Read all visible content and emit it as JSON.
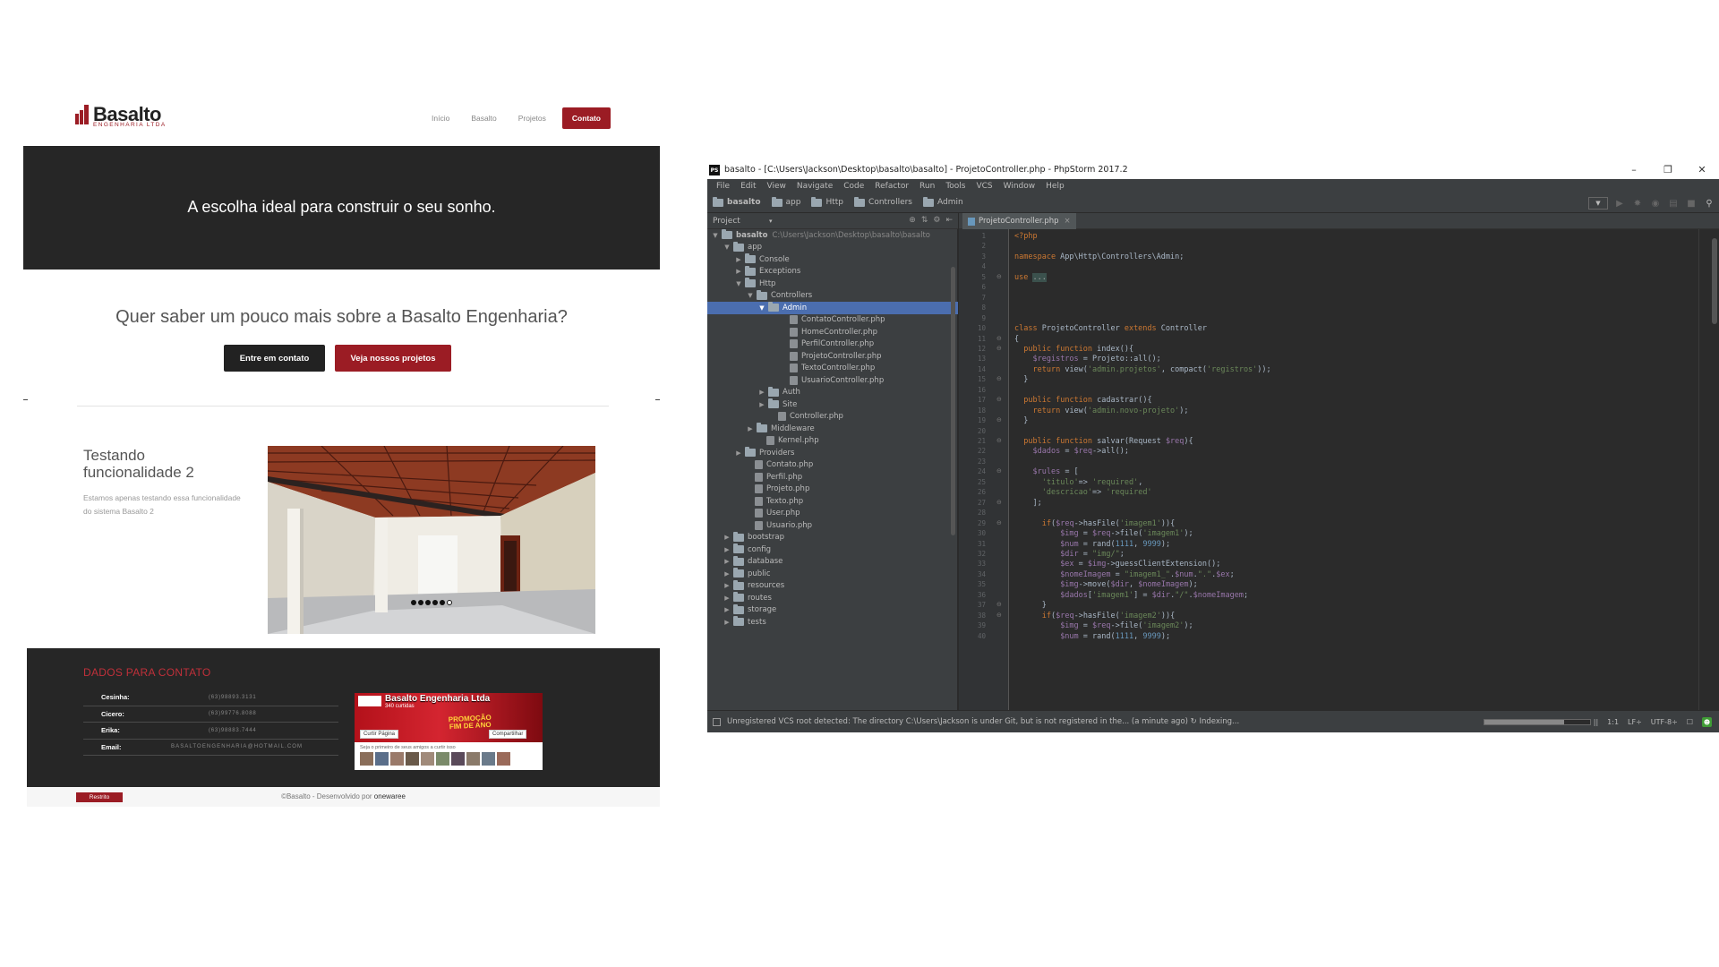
{
  "website": {
    "logo": {
      "name": "Basalto",
      "subtitle": "ENGENHARIA LTDA"
    },
    "nav": [
      "Início",
      "Basalto",
      "Projetos"
    ],
    "nav_cta": "Contato",
    "hero_title": "A escolha ideal para construir o seu sonho.",
    "about_title": "Quer saber um pouco mais sobre a Basalto Engenharia?",
    "btn_contact": "Entre em contato",
    "btn_projects": "Veja nossos projetos",
    "project": {
      "title": "Testando funcionalidade 2",
      "description": "Estamos apenas testando essa funcionalidade do sistema Basalto 2",
      "slide_count": 6,
      "active_slide": 6
    },
    "contact": {
      "heading": "DADOS PARA CONTATO",
      "rows": [
        {
          "name": "Cesinha:",
          "value": "(63)98893.3131"
        },
        {
          "name": "Cicero:",
          "value": "(63)99776.8088"
        },
        {
          "name": "Erika:",
          "value": "(63)98883.7444"
        }
      ],
      "email_label": "Email:",
      "email_value": "BASALTOENGENHARIA@HOTMAIL.COM"
    },
    "facebook": {
      "page_name": "Basalto Engenharia Ltda",
      "likes": "340 curtidas",
      "promo": "PROMOÇÃO\nFIM DE ANO",
      "like_btn": "Curtir Página",
      "share_btn": "Compartilhar",
      "friends_text": "Seja o primeiro de seus amigos a curtir isso"
    },
    "footer": {
      "restrito": "Restrito",
      "copyright": "©Basalto - Desenvolvido por ",
      "developer": "onewaree"
    },
    "accent": "#9b1c24"
  },
  "ide": {
    "window_title": "basalto - [C:\\Users\\Jackson\\Desktop\\basalto\\basalto] - ProjetoController.php - PhpStorm 2017.2",
    "menu": [
      "File",
      "Edit",
      "View",
      "Navigate",
      "Code",
      "Refactor",
      "Run",
      "Tools",
      "VCS",
      "Window",
      "Help"
    ],
    "breadcrumbs": [
      "basalto",
      "app",
      "Http",
      "Controllers",
      "Admin"
    ],
    "project_panel_title": "Project",
    "tree": [
      {
        "label": "basalto",
        "path": "C:\\Users\\Jackson\\Desktop\\basalto\\basalto",
        "depth": 0,
        "type": "folder",
        "expanded": true
      },
      {
        "label": "app",
        "depth": 1,
        "type": "folder",
        "expanded": true
      },
      {
        "label": "Console",
        "depth": 2,
        "type": "folder",
        "expanded": false
      },
      {
        "label": "Exceptions",
        "depth": 2,
        "type": "folder",
        "expanded": false
      },
      {
        "label": "Http",
        "depth": 2,
        "type": "folder",
        "expanded": true
      },
      {
        "label": "Controllers",
        "depth": 3,
        "type": "folder",
        "expanded": true
      },
      {
        "label": "Admin",
        "depth": 4,
        "type": "folder",
        "expanded": true,
        "selected": true
      },
      {
        "label": "ContatoController.php",
        "depth": 6,
        "type": "file"
      },
      {
        "label": "HomeController.php",
        "depth": 6,
        "type": "file"
      },
      {
        "label": "PerfilController.php",
        "depth": 6,
        "type": "file"
      },
      {
        "label": "ProjetoController.php",
        "depth": 6,
        "type": "file"
      },
      {
        "label": "TextoController.php",
        "depth": 6,
        "type": "file"
      },
      {
        "label": "UsuarioController.php",
        "depth": 6,
        "type": "file"
      },
      {
        "label": "Auth",
        "depth": 4,
        "type": "folder",
        "expanded": false
      },
      {
        "label": "Site",
        "depth": 4,
        "type": "folder",
        "expanded": false
      },
      {
        "label": "Controller.php",
        "depth": 5,
        "type": "file"
      },
      {
        "label": "Middleware",
        "depth": 3,
        "type": "folder",
        "expanded": false
      },
      {
        "label": "Kernel.php",
        "depth": 4,
        "type": "file"
      },
      {
        "label": "Providers",
        "depth": 2,
        "type": "folder",
        "expanded": false
      },
      {
        "label": "Contato.php",
        "depth": 3,
        "type": "file"
      },
      {
        "label": "Perfil.php",
        "depth": 3,
        "type": "file"
      },
      {
        "label": "Projeto.php",
        "depth": 3,
        "type": "file"
      },
      {
        "label": "Texto.php",
        "depth": 3,
        "type": "file"
      },
      {
        "label": "User.php",
        "depth": 3,
        "type": "file"
      },
      {
        "label": "Usuario.php",
        "depth": 3,
        "type": "file"
      },
      {
        "label": "bootstrap",
        "depth": 1,
        "type": "folder",
        "expanded": false
      },
      {
        "label": "config",
        "depth": 1,
        "type": "folder",
        "expanded": false
      },
      {
        "label": "database",
        "depth": 1,
        "type": "folder",
        "expanded": false
      },
      {
        "label": "public",
        "depth": 1,
        "type": "folder",
        "expanded": false
      },
      {
        "label": "resources",
        "depth": 1,
        "type": "folder",
        "expanded": false
      },
      {
        "label": "routes",
        "depth": 1,
        "type": "folder",
        "expanded": false
      },
      {
        "label": "storage",
        "depth": 1,
        "type": "folder",
        "expanded": false
      },
      {
        "label": "tests",
        "depth": 1,
        "type": "folder",
        "expanded": false
      }
    ],
    "active_tab": "ProjetoController.php",
    "code_lines": [
      "<?php",
      "",
      "namespace App\\Http\\Controllers\\Admin;",
      "",
      "use ...",
      "",
      "",
      "",
      "",
      "class ProjetoController extends Controller",
      "{",
      "  public function index(){",
      "    $registros = Projeto::all();",
      "    return view('admin.projetos', compact('registros'));",
      "  }",
      "",
      "  public function cadastrar(){",
      "    return view('admin.novo-projeto');",
      "  }",
      "",
      "  public function salvar(Request $req){",
      "    $dados = $req->all();",
      "",
      "    $rules = [",
      "      'titulo'=> 'required',",
      "      'descricao'=> 'required'",
      "    ];",
      "",
      "      if($req->hasFile('imagem1')){",
      "          $img = $req->file('imagem1');",
      "          $num = rand(1111, 9999);",
      "          $dir = \"img/\";",
      "          $ex = $img->guessClientExtension();",
      "          $nomeImagem = \"imagem1_\".$num.\".\".$ex;",
      "          $img->move($dir, $nomeImagem);",
      "          $dados['imagem1'] = $dir.\"/\".$nomeImagem;",
      "      }",
      "      if($req->hasFile('imagem2')){",
      "          $img = $req->file('imagem2');",
      "          $num = rand(1111, 9999);"
    ],
    "status": {
      "message": "Unregistered VCS root detected: The directory C:\\Users\\Jackson is under Git, but is not registered in the... (a minute ago)",
      "indexing": "Indexing...",
      "progress": 0.75,
      "position": "1:1",
      "line_sep": "LF÷",
      "encoding": "UTF-8÷"
    }
  }
}
